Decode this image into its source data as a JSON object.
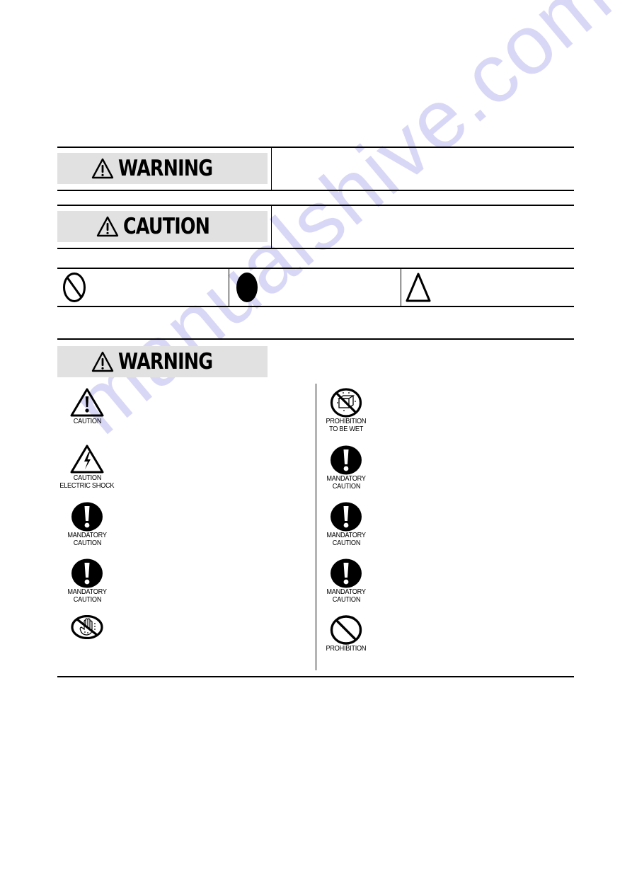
{
  "watermark": {
    "text": "manualshive.com",
    "color": "#d8d8f6"
  },
  "signal_words": {
    "warning": {
      "label": "WARNING",
      "icon": "warning-triangle-icon",
      "description": ""
    },
    "caution": {
      "label": "CAUTION",
      "icon": "warning-triangle-icon",
      "description": ""
    }
  },
  "symbol_legend": [
    {
      "icon": "prohibition-icon",
      "description": ""
    },
    {
      "icon": "mandatory-filled-circle-icon",
      "description": ""
    },
    {
      "icon": "caution-triangle-outline-icon",
      "description": ""
    }
  ],
  "warning_section": {
    "header": "WARNING",
    "left_column": [
      {
        "icon": "caution-exclamation-triangle-icon",
        "label_lines": [
          "CAUTION"
        ]
      },
      {
        "icon": "electric-shock-triangle-icon",
        "label_lines": [
          "CAUTION",
          "ELECTRIC SHOCK"
        ]
      },
      {
        "icon": "mandatory-exclamation-icon",
        "label_lines": [
          "MANDATORY",
          "CAUTION"
        ]
      },
      {
        "icon": "mandatory-exclamation-icon",
        "label_lines": [
          "MANDATORY",
          "CAUTION"
        ]
      },
      {
        "icon": "no-wet-hands-icon",
        "label_lines": []
      }
    ],
    "right_column": [
      {
        "icon": "prohibition-to-be-wet-icon",
        "label_lines": [
          "PROHIBITION",
          "TO BE WET"
        ]
      },
      {
        "icon": "mandatory-exclamation-icon",
        "label_lines": [
          "MANDATORY",
          "CAUTION"
        ]
      },
      {
        "icon": "mandatory-exclamation-icon",
        "label_lines": [
          "MANDATORY",
          "CAUTION"
        ]
      },
      {
        "icon": "mandatory-exclamation-icon",
        "label_lines": [
          "MANDATORY",
          "CAUTION"
        ]
      },
      {
        "icon": "prohibition-icon",
        "label_lines": [
          "PROHIBITION"
        ]
      }
    ]
  },
  "colors": {
    "banner_background": "#e1e1e1",
    "rule": "#000000"
  }
}
